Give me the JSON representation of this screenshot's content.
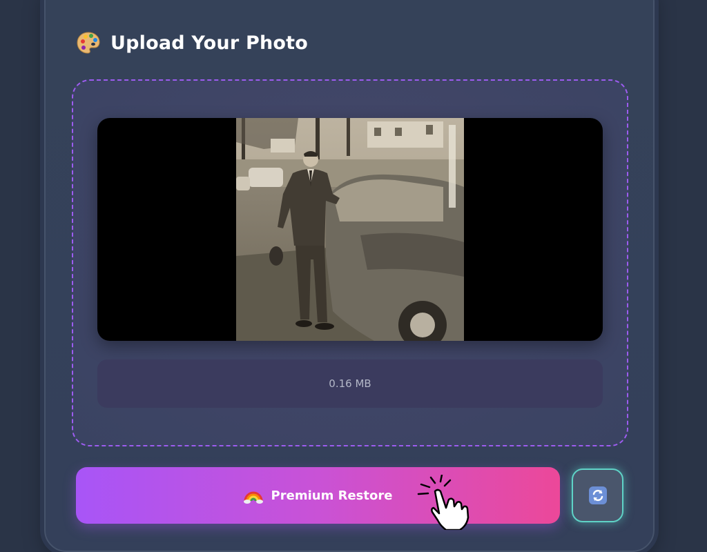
{
  "upload_card": {
    "title": "Upload Your Photo",
    "title_icon": "palette-icon"
  },
  "dropzone": {
    "preview_image": "vintage-photo-man-with-car",
    "file_size": "0.16 MB"
  },
  "actions": {
    "restore_label": "Premium Restore",
    "restore_icon": "rainbow-icon",
    "refresh_icon": "refresh-icon"
  },
  "colors": {
    "accent_start": "#a855f7",
    "accent_end": "#ec4899",
    "dropzone_border": "#9d5cf0",
    "refresh_glow": "#5fd3c7"
  }
}
